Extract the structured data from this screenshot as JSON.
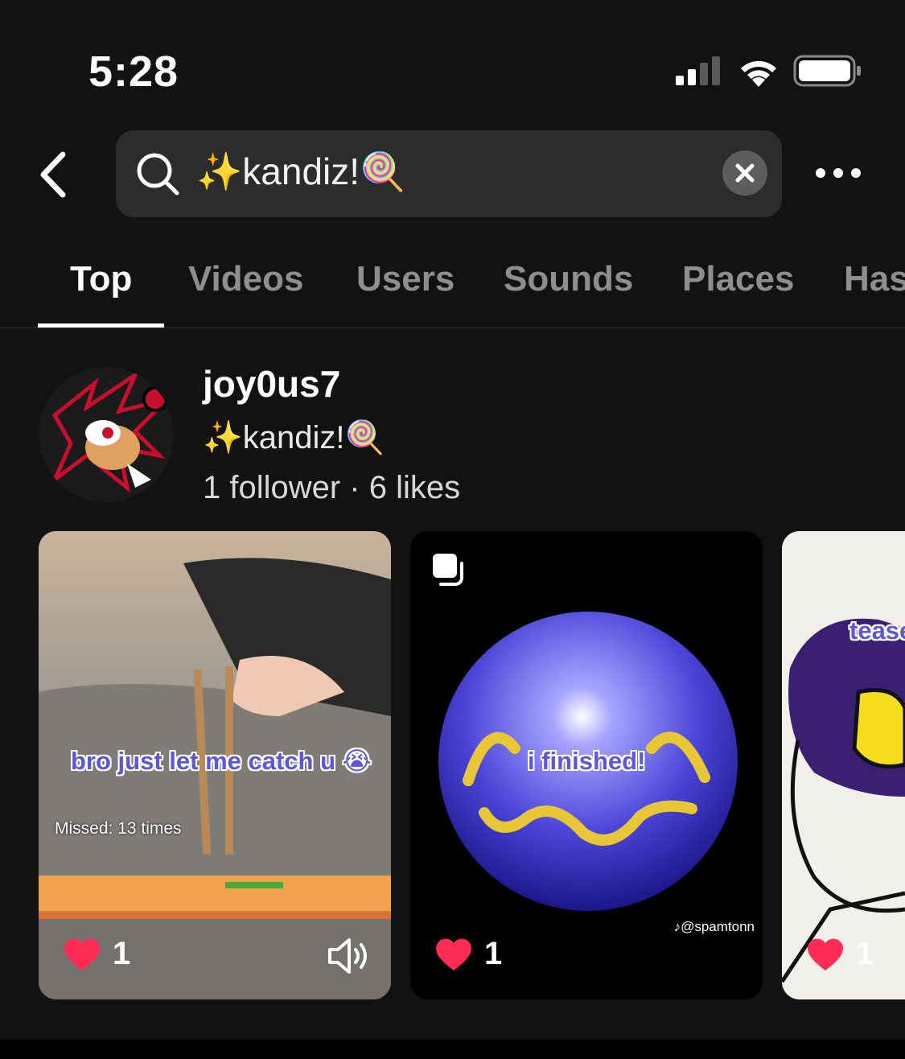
{
  "status_bar": {
    "time": "5:28",
    "icons": [
      "signal-icon",
      "wifi-icon",
      "battery-icon"
    ]
  },
  "search": {
    "query": "✨kandiz!🍭",
    "search_icon": "search-icon",
    "clear_icon": "clear-icon"
  },
  "header": {
    "back_icon": "back-icon",
    "more_icon": "more-icon"
  },
  "tabs": [
    {
      "label": "Top",
      "active": true
    },
    {
      "label": "Videos"
    },
    {
      "label": "Users"
    },
    {
      "label": "Sounds"
    },
    {
      "label": "Places"
    },
    {
      "label": "Has"
    }
  ],
  "user": {
    "username": "joy0us7",
    "display_name": "✨kandiz!🍭",
    "stats": "1 follower · 6 likes"
  },
  "videos": [
    {
      "caption": "bro just let me catch u 😭",
      "overlay": "Missed: 13 times",
      "likes": "1",
      "sound_icon": "volume-icon"
    },
    {
      "caption": "i finished!",
      "watermark": "@spamtonn",
      "likes": "1",
      "badge_icon": "multi-photo-icon"
    },
    {
      "caption": "tease",
      "likes": "1"
    }
  ],
  "colors": {
    "accent": "#ffffff",
    "background": "#121212",
    "heart": "#fe2c55"
  }
}
